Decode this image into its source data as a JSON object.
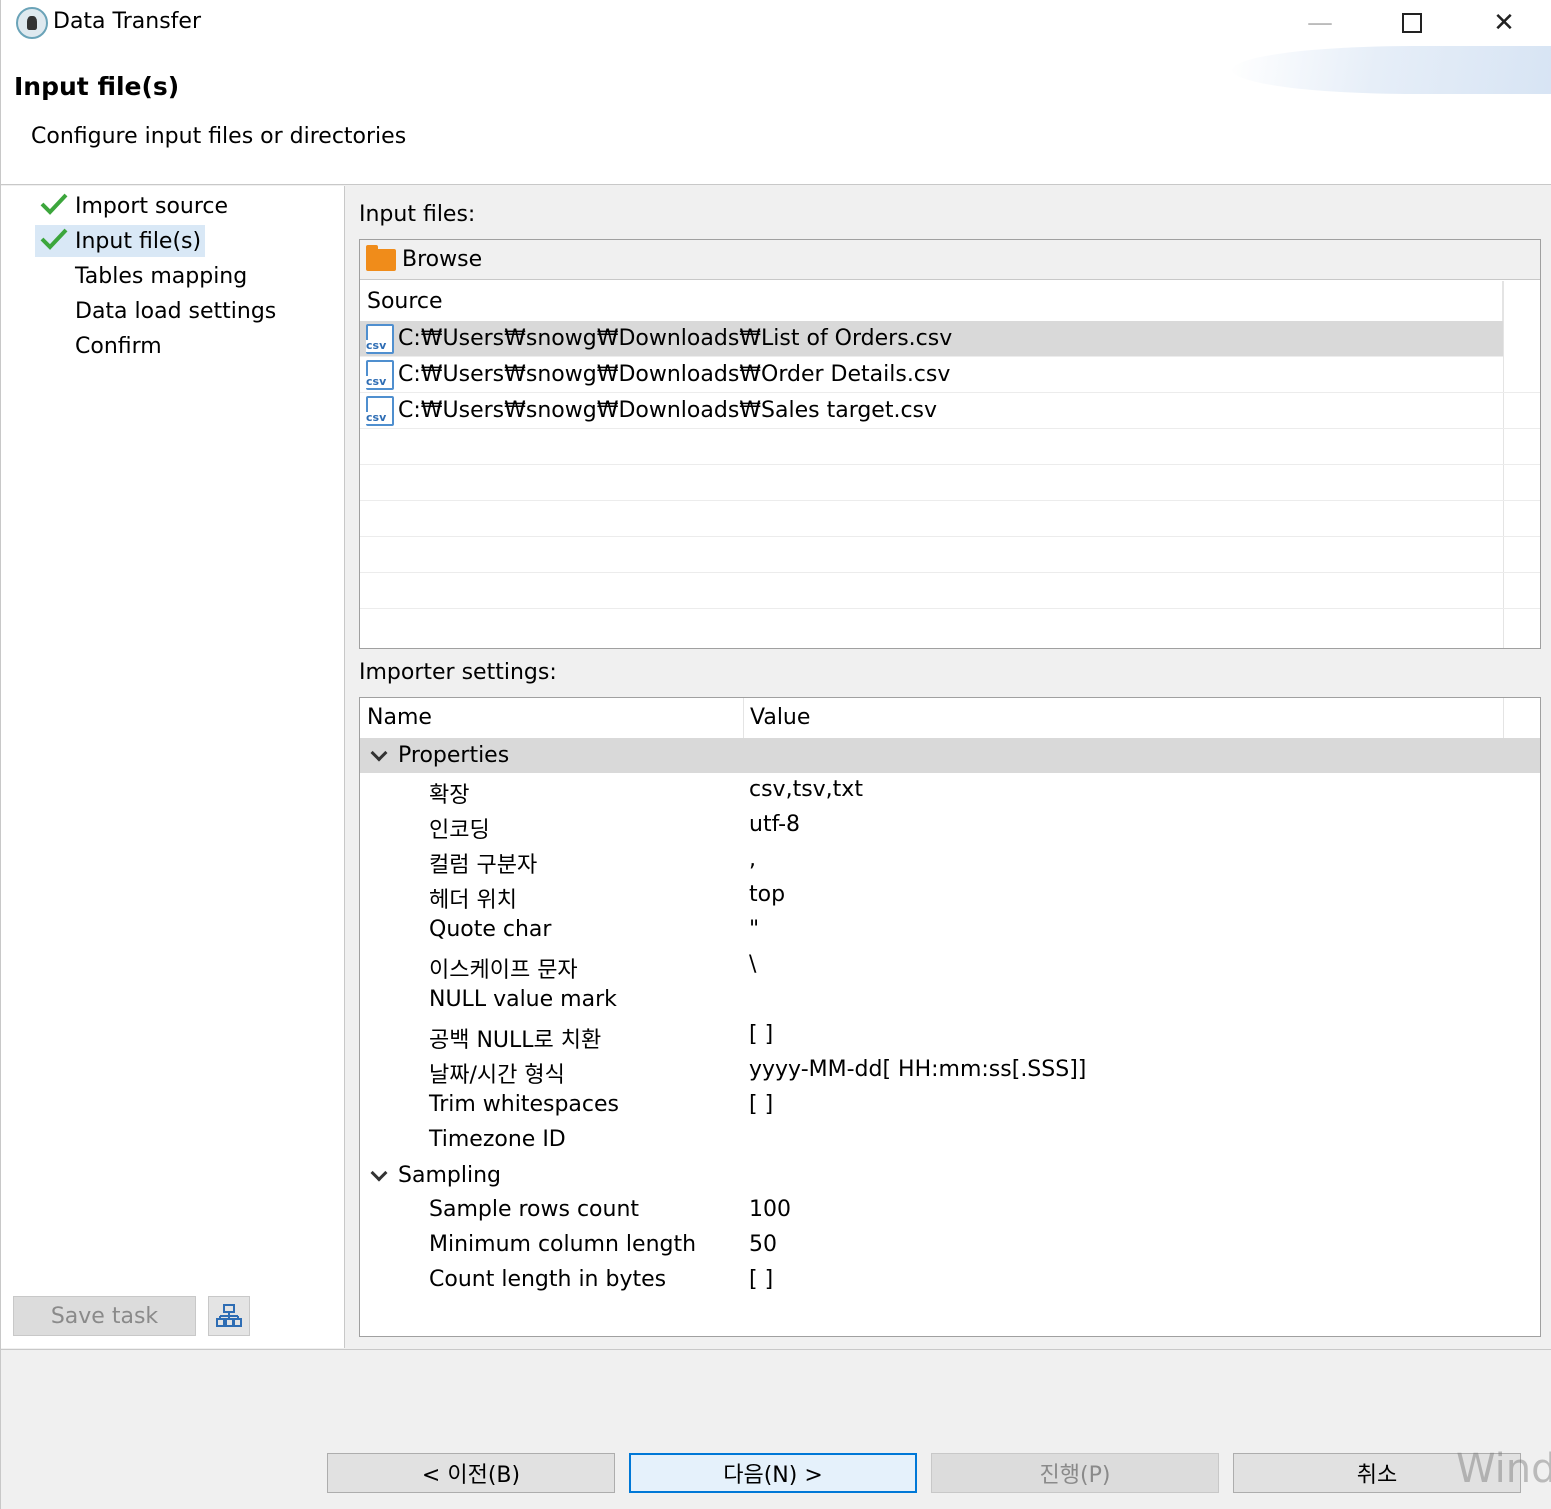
{
  "window": {
    "title": "Data Transfer",
    "controls": {
      "minimize": "—",
      "close": "✕"
    }
  },
  "header": {
    "title": "Input file(s)",
    "description": "Configure input files or directories"
  },
  "nav": {
    "items": [
      {
        "label": "Import source",
        "done": true
      },
      {
        "label": "Input file(s)",
        "done": true,
        "selected": true
      },
      {
        "label": "Tables mapping",
        "done": false
      },
      {
        "label": "Data load settings",
        "done": false
      },
      {
        "label": "Confirm",
        "done": false
      }
    ],
    "save_task": "Save task"
  },
  "input_files": {
    "label": "Input files:",
    "browse": "Browse",
    "column": "Source",
    "rows": [
      "C:₩Users₩snowg₩Downloads₩List of Orders.csv",
      "C:₩Users₩snowg₩Downloads₩Order Details.csv",
      "C:₩Users₩snowg₩Downloads₩Sales target.csv"
    ],
    "csv_icon_text": "csv"
  },
  "importer": {
    "label": "Importer settings:",
    "col_name": "Name",
    "col_value": "Value",
    "groups": [
      {
        "name": "Properties",
        "props": [
          {
            "name": "확장",
            "value": "csv,tsv,txt"
          },
          {
            "name": "인코딩",
            "value": "utf-8"
          },
          {
            "name": "컬럼 구분자",
            "value": ","
          },
          {
            "name": "헤더 위치",
            "value": "top"
          },
          {
            "name": "Quote char",
            "value": "\""
          },
          {
            "name": "이스케이프 문자",
            "value": "\\"
          },
          {
            "name": "NULL value mark",
            "value": ""
          },
          {
            "name": "공백 NULL로 치환",
            "value": "[ ]"
          },
          {
            "name": "날짜/시간 형식",
            "value": "yyyy-MM-dd[ HH:mm:ss[.SSS]]"
          },
          {
            "name": "Trim whitespaces",
            "value": "[ ]"
          },
          {
            "name": "Timezone ID",
            "value": ""
          }
        ]
      },
      {
        "name": "Sampling",
        "props": [
          {
            "name": "Sample rows count",
            "value": "100"
          },
          {
            "name": "Minimum column length",
            "value": "50"
          },
          {
            "name": "Count length in bytes",
            "value": "[ ]"
          }
        ]
      }
    ]
  },
  "buttons": {
    "back": "< 이전(B)",
    "next": "다음(N) >",
    "proceed": "진행(P)",
    "cancel": "취소"
  },
  "watermark": "Wind",
  "colors": {
    "accent": "#0078d7",
    "check": "#3ca63c",
    "folder": "#f08c1a",
    "csv": "#2e6db4"
  }
}
